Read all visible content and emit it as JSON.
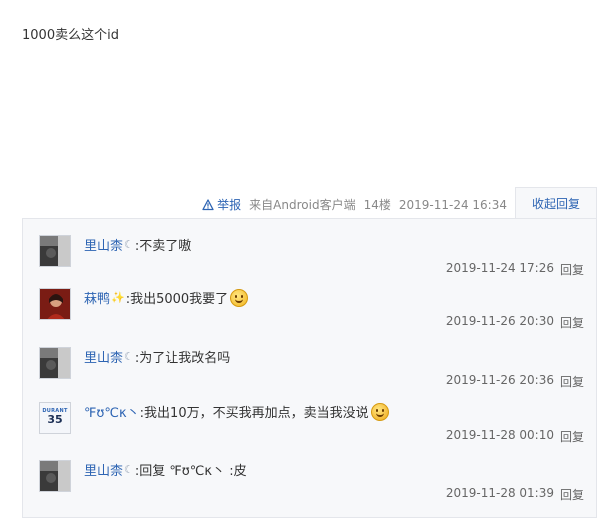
{
  "post": {
    "text": "1000卖么这个id"
  },
  "meta": {
    "report_label": "举报",
    "source": "来自Android客户端",
    "floor": "14楼",
    "timestamp": "2019-11-24 16:34",
    "collapse_label": "收起回复"
  },
  "replies": [
    {
      "avatar": "avatar-dark-photo-icon",
      "username": "里山柰",
      "badge": "☾",
      "text": ":不卖了嗷",
      "time": "2019-11-24 17:26",
      "reply_label": "回复"
    },
    {
      "avatar": "avatar-red-photo-icon",
      "username": "菻鸭",
      "badge": "✨",
      "text": ":我出5000我要了",
      "emoji": "smile-emoji-icon",
      "time": "2019-11-26 20:30",
      "reply_label": "回复"
    },
    {
      "avatar": "avatar-dark-photo-icon",
      "username": "里山柰",
      "badge": "☾",
      "text": ":为了让我改名吗",
      "time": "2019-11-26 20:36",
      "reply_label": "回复"
    },
    {
      "avatar": "avatar-jersey-icon",
      "avatar_text_top": "DURANT",
      "avatar_text_num": "35",
      "username": "℉ʊ℃κ丶",
      "badge": "",
      "text": ":我出10万，不买我再加点，卖当我没说",
      "emoji": "laugh-emoji-icon",
      "time": "2019-11-28 00:10",
      "reply_label": "回复"
    },
    {
      "avatar": "avatar-dark-photo-icon",
      "username": "里山柰",
      "badge": "☾",
      "text": ":回复 ℉ʊ℃κ丶 :皮",
      "time": "2019-11-28 01:39",
      "reply_label": "回复"
    }
  ],
  "colors": {
    "link": "#2d64b3",
    "panel_bg": "#f7f8fa",
    "panel_border": "#e4e6eb"
  }
}
